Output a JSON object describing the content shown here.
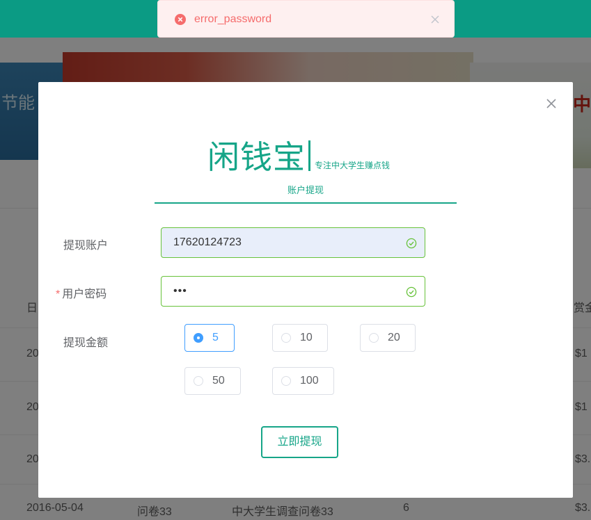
{
  "toast": {
    "message": "error_password",
    "type": "error"
  },
  "background": {
    "banner_left_text": "节能",
    "banner_right_text": "中",
    "table_head": {
      "date": "日",
      "reward": "赏金"
    },
    "rows": [
      {
        "date": "20",
        "reward": "$1"
      },
      {
        "date": "20",
        "reward": "$1"
      },
      {
        "date": "20",
        "reward": "$3."
      },
      {
        "date": "2016-05-04",
        "name": "问卷33",
        "desc": "中大学生调查问卷33",
        "count": "6",
        "reward": "$3."
      }
    ]
  },
  "dialog": {
    "brand_name": "闲钱宝",
    "slogan": "专注中大学生赚点钱",
    "tab_label": "账户提现",
    "account": {
      "label": "提现账户",
      "value": "17620124723"
    },
    "password": {
      "label": "用户密码",
      "required_mark": "*",
      "value": "•••"
    },
    "amount": {
      "label": "提现金额",
      "options": [
        "5",
        "10",
        "20",
        "50",
        "100"
      ],
      "selected": "5"
    },
    "submit_label": "立即提现"
  },
  "colors": {
    "brand": "#16a588",
    "topbar": "#0b9b84",
    "success": "#67c23a",
    "primary": "#409eff",
    "error": "#f56c6c"
  },
  "icons": {
    "toast": "error-circle-icon",
    "close": "close-icon",
    "valid": "check-circle-icon"
  }
}
